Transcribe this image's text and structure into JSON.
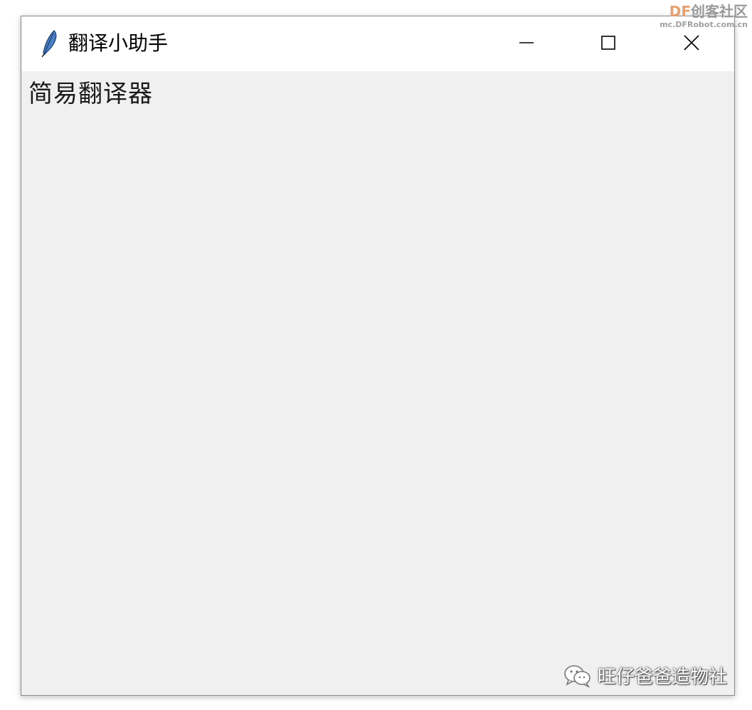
{
  "window": {
    "title": "翻译小助手",
    "controls": {
      "minimize": "minimize",
      "maximize": "maximize",
      "close": "close"
    }
  },
  "content": {
    "heading": "简易翻译器"
  },
  "site_logo": {
    "brand_prefix": "DF",
    "brand_suffix": "创客社区",
    "url": "mc.DFRobot.com.cn"
  },
  "watermark": {
    "text": "旺仔爸爸造物社",
    "icon": "wechat-icon"
  },
  "icons": {
    "app": "feather-icon",
    "minimize": "minimize-icon",
    "maximize": "maximize-icon",
    "close": "close-icon"
  },
  "colors": {
    "titlebar_bg": "#ffffff",
    "content_bg": "#f0f0f0",
    "window_border": "#8a8a8a"
  }
}
